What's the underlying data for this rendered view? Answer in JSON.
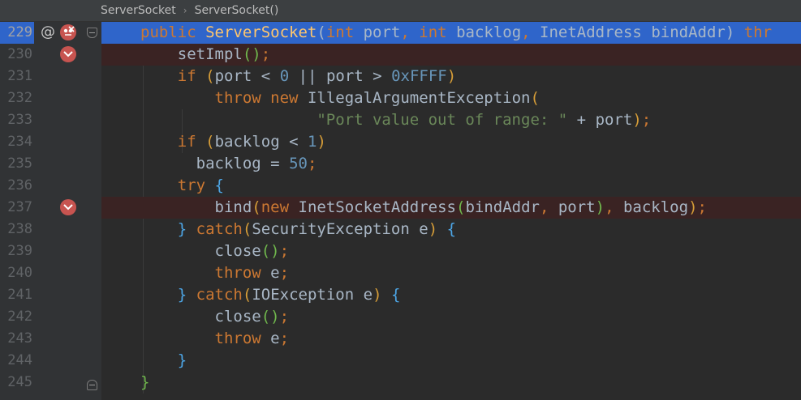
{
  "breadcrumb": {
    "items": [
      "ServerSocket",
      "ServerSocket()"
    ],
    "separator": "›"
  },
  "editor": {
    "lines": [
      {
        "num": "229"
      },
      {
        "num": "230"
      },
      {
        "num": "231"
      },
      {
        "num": "232"
      },
      {
        "num": "233"
      },
      {
        "num": "234"
      },
      {
        "num": "235"
      },
      {
        "num": "236"
      },
      {
        "num": "237"
      },
      {
        "num": "238"
      },
      {
        "num": "239"
      },
      {
        "num": "240"
      },
      {
        "num": "241"
      },
      {
        "num": "242"
      },
      {
        "num": "243"
      },
      {
        "num": "244"
      },
      {
        "num": "245"
      }
    ],
    "gutter": {
      "annotation_symbol": "@"
    },
    "tokens": {
      "public": "public",
      "ServerSocket": "ServerSocket",
      "int": "int",
      "port": "port",
      "backlog": "backlog",
      "InetAddress": "InetAddress",
      "bindAddr": "bindAddr",
      "throws": "thr",
      "setImpl": "setImpl",
      "if": "if",
      "lt": "<",
      "gt": ">",
      "or": "||",
      "zero": "0",
      "hex": "0xFFFF",
      "throw": "throw",
      "new": "new",
      "IllegalArgumentException": "IllegalArgumentException",
      "str_port": "\"Port value out of range: \"",
      "plus": "+",
      "one": "1",
      "fifty": "50",
      "try": "try",
      "bind": "bind",
      "InetSocketAddress": "InetSocketAddress",
      "catch": "catch",
      "SecurityException": "SecurityException",
      "IOException": "IOException",
      "e": "e",
      "close": "close",
      "eq": "="
    }
  },
  "colors": {
    "background": "#2b2b2b",
    "gutter": "#313335",
    "current_line": "#2f65ca",
    "breakpoint_line": "#3a2323",
    "breakpoint": "#c75450",
    "keyword": "#cc7832",
    "method": "#ffc66d",
    "number": "#6897bb",
    "string": "#6a8759",
    "text": "#a9b7c6"
  },
  "icons": {
    "breakpoint": "breakpoint-check-icon",
    "method_breakpoint": "method-breakpoint-icon",
    "override": "annotation-at-icon",
    "fold": "fold-icon"
  }
}
